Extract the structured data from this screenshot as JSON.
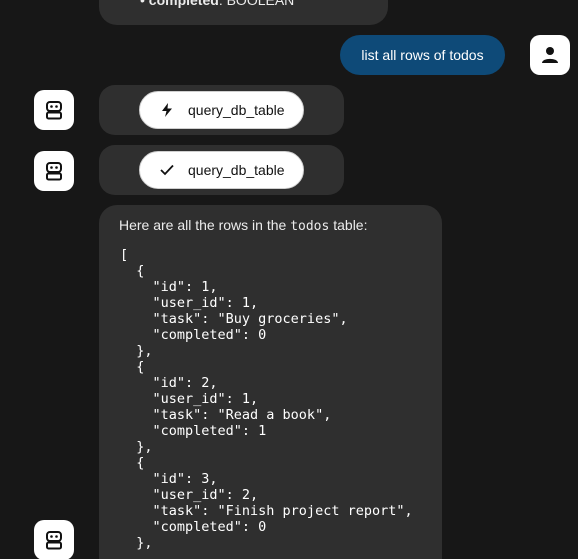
{
  "conversation": {
    "previous_message_fragment": {
      "field_name": "completed",
      "field_type": ": BOOLEAN"
    },
    "user_message": {
      "text": "list all rows of todos"
    },
    "tool_calls": [
      {
        "name": "query_db_table",
        "state": "running",
        "icon": "bolt-icon"
      },
      {
        "name": "query_db_table",
        "state": "done",
        "icon": "check-icon"
      }
    ],
    "response": {
      "intro_before": "Here are all the rows in the ",
      "intro_code": "todos",
      "intro_after": " table:",
      "json_text": "[\n  {\n    \"id\": 1,\n    \"user_id\": 1,\n    \"task\": \"Buy groceries\",\n    \"completed\": 0\n  },\n  {\n    \"id\": 2,\n    \"user_id\": 1,\n    \"task\": \"Read a book\",\n    \"completed\": 1\n  },\n  {\n    \"id\": 3,\n    \"user_id\": 2,\n    \"task\": \"Finish project report\",\n    \"completed\": 0\n  },"
    }
  },
  "colors": {
    "background": "#171717",
    "bubble": "#2f2f2f",
    "user_bubble": "#0e4a78",
    "chip_background": "#ffffff"
  }
}
